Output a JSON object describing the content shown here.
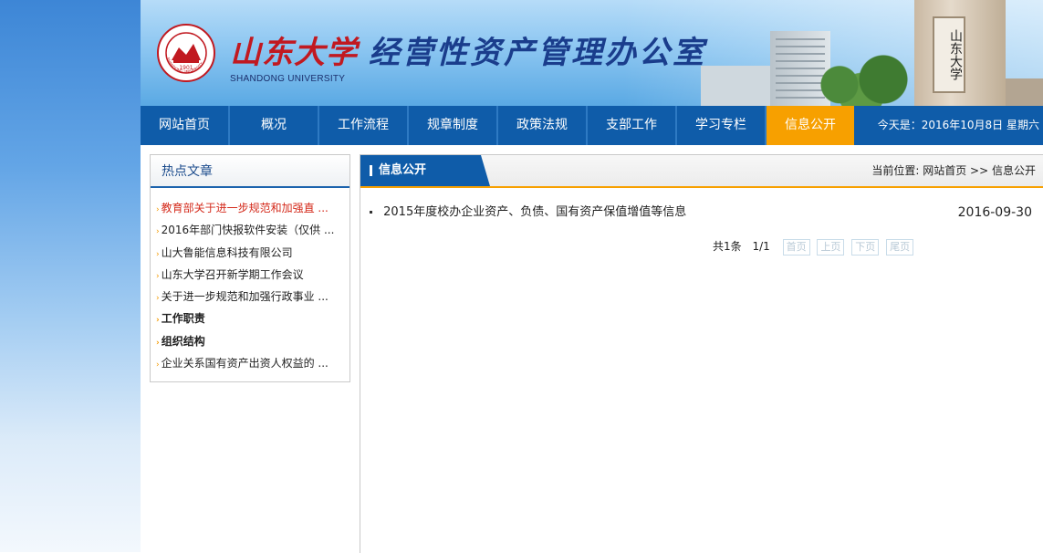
{
  "header": {
    "title_sdu": "山东大学",
    "title_office": "经营性资产管理办公室",
    "subtitle_en": "SHANDONG UNIVERSITY",
    "logo_year": "1901",
    "logo_ring_text": "SHANDONG UNIVERSITY",
    "plaque_text": "山东大学"
  },
  "nav": {
    "items": [
      "网站首页",
      "概况",
      "工作流程",
      "规章制度",
      "政策法规",
      "支部工作",
      "学习专栏",
      "信息公开"
    ],
    "active": "信息公开",
    "today": "今天是：2016年10月8日  星期六"
  },
  "sidebar": {
    "title": "热点文章",
    "items": [
      "教育部关于进一步规范和加强直 ...",
      "2016年部门快报软件安装（仅供 ...",
      "山大鲁能信息科技有限公司",
      "山东大学召开新学期工作会议",
      "关于进一步规范和加强行政事业 ...",
      "工作职责",
      "组织结构",
      "企业关系国有资产出资人权益的 ..."
    ]
  },
  "main": {
    "tab_title": "信息公开",
    "breadcrumb_prefix": "当前位置:",
    "breadcrumb_home": "网站首页",
    "breadcrumb_sep": ">>",
    "breadcrumb_current": "信息公开",
    "news": [
      {
        "title": "2015年度校办企业资产、负债、国有资产保值增值等信息",
        "date": "2016-09-30"
      }
    ],
    "pager": {
      "count": "共1条",
      "page": "1/1",
      "first": "首页",
      "prev": "上页",
      "next": "下页",
      "last": "尾页"
    }
  },
  "colors": {
    "nav_bg": "#0f5ca9",
    "nav_active": "#f7a000",
    "sdu_red": "#c11920",
    "office_blue": "#1a3d8c"
  }
}
